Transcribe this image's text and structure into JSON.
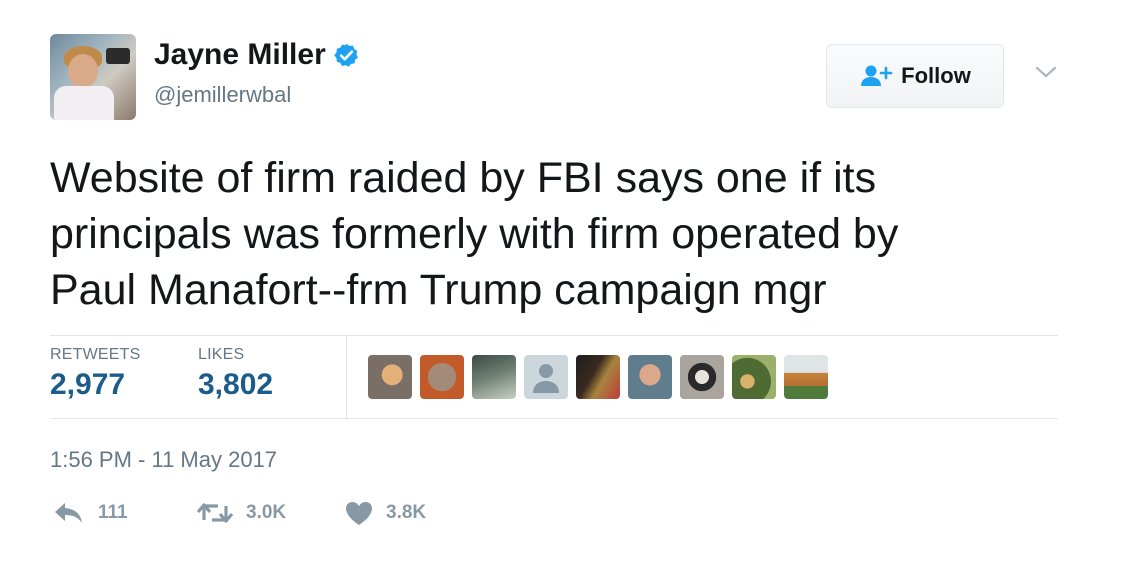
{
  "author": {
    "name": "Jayne Miller",
    "handle": "@jemillerwbal",
    "verified": true
  },
  "follow_button": {
    "label": "Follow"
  },
  "tweet": {
    "lines": [
      "Website of firm raided by FBI says one if its",
      "principals was formerly with firm operated by",
      "Paul Manafort--frm Trump campaign mgr"
    ],
    "timestamp": "1:56 PM - 11 May 2017"
  },
  "stats": {
    "retweets_label": "RETWEETS",
    "retweets_value": "2,977",
    "likes_label": "LIKES",
    "likes_value": "3,802"
  },
  "liker_avatars": [
    "cat-photo",
    "rock-photo",
    "outdoor-photo",
    "default-avatar",
    "person-photo",
    "portrait-photo",
    "dog-photo",
    "garden-photo",
    "cat-lying-photo"
  ],
  "actions": {
    "reply_count": "111",
    "retweet_count": "3.0K",
    "like_count": "3.8K"
  },
  "colors": {
    "accent": "#1da1f2",
    "stat_value": "#1b5c8a",
    "muted": "#657786",
    "action_gray": "#8899a6"
  }
}
